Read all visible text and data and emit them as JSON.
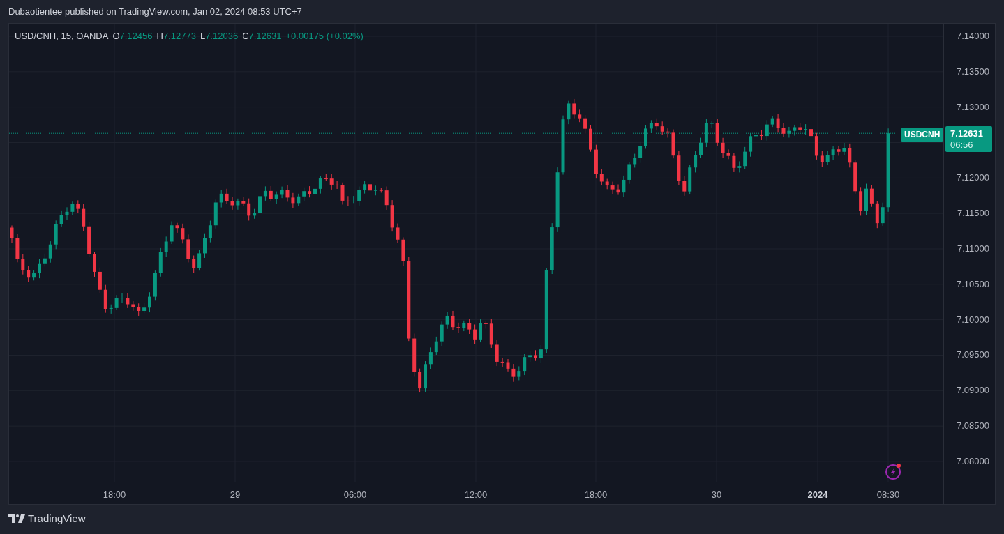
{
  "publish_line": "Dubaotientee published on TradingView.com, Jan 02, 2024 08:53 UTC+7",
  "legend": {
    "symbol": "USD/CNH, 15, OANDA",
    "ohlc": [
      {
        "letter": "O",
        "value": "7.12456"
      },
      {
        "letter": "H",
        "value": "7.12773"
      },
      {
        "letter": "L",
        "value": "7.12036"
      },
      {
        "letter": "C",
        "value": "7.12631"
      }
    ],
    "change": "+0.00175 (+0.02%)"
  },
  "price_axis": [
    "7.14000",
    "7.13500",
    "7.13000",
    "7.12000",
    "7.11500",
    "7.11000",
    "7.10500",
    "7.10000",
    "7.09500",
    "7.09000",
    "7.08500",
    "7.08000"
  ],
  "time_axis": [
    {
      "label": "18:00",
      "bold": false
    },
    {
      "label": "29",
      "bold": false
    },
    {
      "label": "06:00",
      "bold": false
    },
    {
      "label": "12:00",
      "bold": false
    },
    {
      "label": "18:00",
      "bold": false
    },
    {
      "label": "30",
      "bold": false
    },
    {
      "label": "2024",
      "bold": true
    },
    {
      "label": "08:30",
      "bold": false
    }
  ],
  "last_price": {
    "symbol": "USDCNH",
    "price": "7.12631",
    "countdown": "06:56"
  },
  "brand": "TradingView"
}
